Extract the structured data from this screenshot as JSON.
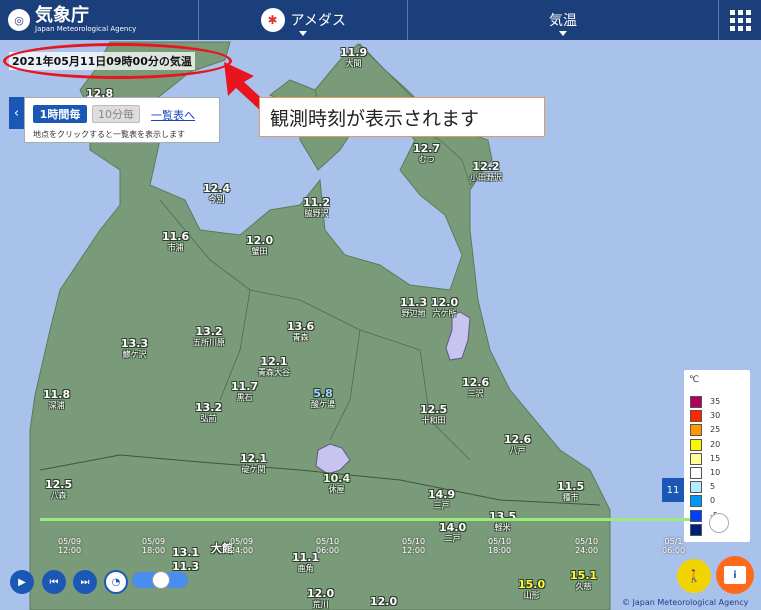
{
  "header": {
    "logo_title": "気象庁",
    "logo_sub": "Japan Meteorological Agency",
    "tab_amedas": "アメダス",
    "tab_element": "気温"
  },
  "timestamp": "2021年05月11日09時00分の気温",
  "callout": "観測時刻が表示されます",
  "panel": {
    "btn_hourly": "1時間毎",
    "btn_10min": "10分毎",
    "link_list": "一覧表へ",
    "hint": "地点をクリックすると一覧表を表示します"
  },
  "stations": [
    {
      "value": "11.9",
      "name": "大間",
      "color": "white"
    },
    {
      "value": "12.8",
      "name": "",
      "color": "white"
    },
    {
      "value": "12.7",
      "name": "むつ",
      "color": "white"
    },
    {
      "value": "12.2",
      "name": "小田野沢",
      "color": "white"
    },
    {
      "value": "12.4",
      "name": "今別",
      "color": "white"
    },
    {
      "value": "11.2",
      "name": "脇野沢",
      "color": "white"
    },
    {
      "value": "11.6",
      "name": "市浦",
      "color": "white"
    },
    {
      "value": "12.0",
      "name": "蟹田",
      "color": "white"
    },
    {
      "value": "11.3",
      "name": "野辺地",
      "color": "white"
    },
    {
      "value": "12.0",
      "name": "六ケ所",
      "color": "white"
    },
    {
      "value": "13.3",
      "name": "鯵ケ沢",
      "color": "white"
    },
    {
      "value": "13.2",
      "name": "五所川原",
      "color": "white"
    },
    {
      "value": "13.6",
      "name": "青森",
      "color": "white"
    },
    {
      "value": "12.1",
      "name": "青森大谷",
      "color": "white"
    },
    {
      "value": "11.7",
      "name": "黒石",
      "color": "white"
    },
    {
      "value": "5.8",
      "name": "酸ケ湯",
      "color": "blue"
    },
    {
      "value": "12.6",
      "name": "三沢",
      "color": "white"
    },
    {
      "value": "11.8",
      "name": "深浦",
      "color": "white"
    },
    {
      "value": "13.2",
      "name": "弘前",
      "color": "white"
    },
    {
      "value": "12.5",
      "name": "十和田",
      "color": "white"
    },
    {
      "value": "12.1",
      "name": "碇ケ関",
      "color": "white"
    },
    {
      "value": "12.6",
      "name": "八戸",
      "color": "white"
    },
    {
      "value": "10.4",
      "name": "休屋",
      "color": "pale"
    },
    {
      "value": "12.5",
      "name": "八森",
      "color": "white"
    },
    {
      "value": "14.9",
      "name": "三戸",
      "color": "white"
    },
    {
      "value": "11.5",
      "name": "種市",
      "color": "white"
    },
    {
      "value": "13.5",
      "name": "軽米",
      "color": "white"
    },
    {
      "value": "14.0",
      "name": "二戸",
      "color": "white"
    },
    {
      "value": "13.1",
      "name": "",
      "color": "white"
    },
    {
      "value": "11.3",
      "name": "",
      "color": "white"
    },
    {
      "value": "大館",
      "name": "",
      "color": "white"
    },
    {
      "value": "11.1",
      "name": "鹿角",
      "color": "white"
    },
    {
      "value": "12.0",
      "name": "荒川",
      "color": "white"
    },
    {
      "value": "12.0",
      "name": "",
      "color": "white"
    },
    {
      "value": "15.0",
      "name": "山形",
      "color": "yellow"
    },
    {
      "value": "15.1",
      "name": "久慈",
      "color": "yellow"
    }
  ],
  "legend": {
    "unit": "℃",
    "items": [
      {
        "label": "35",
        "color": "#b4005a"
      },
      {
        "label": "30",
        "color": "#ff2800"
      },
      {
        "label": "25",
        "color": "#ff9900"
      },
      {
        "label": "20",
        "color": "#faf500"
      },
      {
        "label": "15",
        "color": "#ffff96"
      },
      {
        "label": "10",
        "color": "#ffffff"
      },
      {
        "label": "5",
        "color": "#b9ebff"
      },
      {
        "label": "0",
        "color": "#0096ff"
      },
      {
        "label": "-5",
        "color": "#0041ff"
      },
      {
        "label": "",
        "color": "#002080"
      }
    ]
  },
  "timeline": {
    "ticks": [
      {
        "d": "05/09",
        "t": "12:00"
      },
      {
        "d": "05/09",
        "t": "18:00"
      },
      {
        "d": "05/09",
        "t": "24:00"
      },
      {
        "d": "05/10",
        "t": "06:00"
      },
      {
        "d": "05/10",
        "t": "12:00"
      },
      {
        "d": "05/10",
        "t": "18:00"
      },
      {
        "d": "05/10",
        "t": "24:00"
      },
      {
        "d": "05/1",
        "t": "06:00"
      }
    ],
    "current": "11"
  },
  "copyright": "© Japan Meteorological Agency",
  "colors": {
    "land": "#7a9b79",
    "sea": "#a9c2ec",
    "header": "#1b3f7a",
    "accent": "#1b57b5",
    "ring": "#e8141e"
  }
}
